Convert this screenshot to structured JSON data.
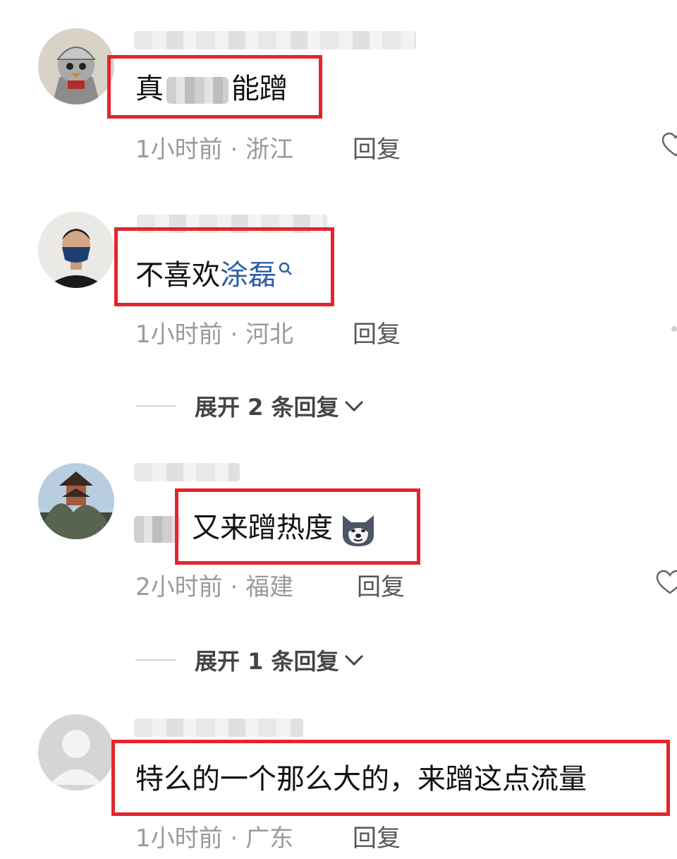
{
  "comments": [
    {
      "text_visible_end": "能蹭",
      "text_visible_start": "真",
      "time": "1小时前",
      "location": "浙江",
      "reply_label": "回复"
    },
    {
      "text_plain": "不喜欢",
      "text_link": "涂磊",
      "time": "1小时前",
      "location": "河北",
      "reply_label": "回复",
      "expand_label": "展开 2 条回复"
    },
    {
      "text_visible_end": "又来蹭热度",
      "time": "2小时前",
      "location": "福建",
      "reply_label": "回复",
      "expand_label": "展开 1 条回复"
    },
    {
      "text": "特么的一个那么大的，来蹭这点流量",
      "time": "1小时前",
      "location": "广东",
      "reply_label": "回复"
    }
  ],
  "meta_separator": "·",
  "colors": {
    "highlight": "#e3262c",
    "link": "#2c5ea7",
    "meta": "#9a9a9a"
  },
  "icons": [
    "like-heart-icon",
    "search-icon",
    "chevron-down-icon",
    "husky-emoji-icon"
  ]
}
